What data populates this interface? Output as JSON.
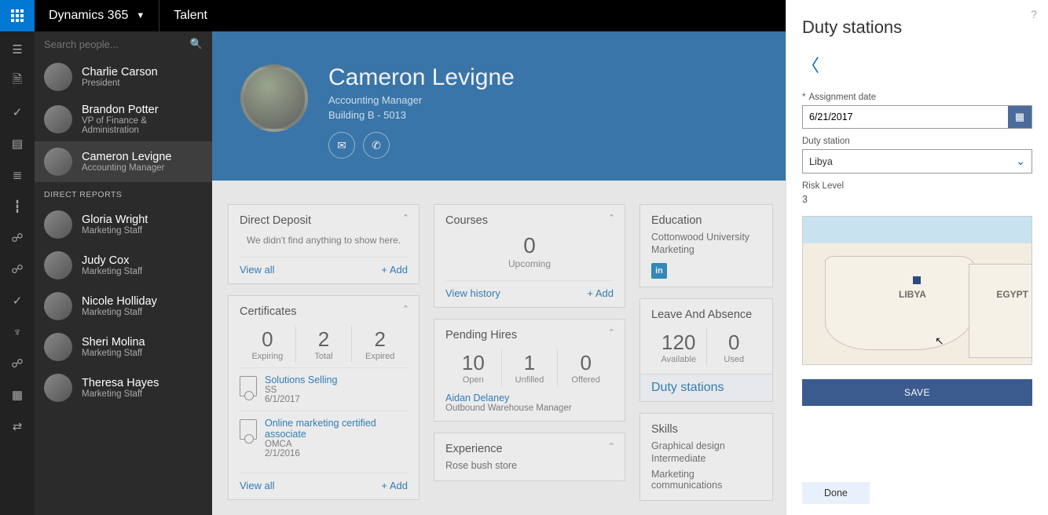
{
  "topbar": {
    "brand": "Dynamics 365",
    "module": "Talent"
  },
  "search": {
    "placeholder": "Search people..."
  },
  "people": [
    {
      "name": "Charlie Carson",
      "title": "President"
    },
    {
      "name": "Brandon Potter",
      "title": "VP of Finance & Administration"
    },
    {
      "name": "Cameron Levigne",
      "title": "Accounting Manager",
      "selected": true
    }
  ],
  "direct_reports_label": "DIRECT REPORTS",
  "reports": [
    {
      "name": "Gloria Wright",
      "title": "Marketing Staff"
    },
    {
      "name": "Judy Cox",
      "title": "Marketing Staff"
    },
    {
      "name": "Nicole Holliday",
      "title": "Marketing Staff"
    },
    {
      "name": "Sheri Molina",
      "title": "Marketing Staff"
    },
    {
      "name": "Theresa Hayes",
      "title": "Marketing Staff"
    }
  ],
  "hero": {
    "name": "Cameron Levigne",
    "role": "Accounting Manager",
    "building": "Building B - 5013"
  },
  "cards": {
    "direct_deposit": {
      "title": "Direct Deposit",
      "empty": "We didn't find anything to show here.",
      "view_all": "View all",
      "add": "Add"
    },
    "certificates": {
      "title": "Certificates",
      "stats": [
        {
          "n": "0",
          "l": "Expiring"
        },
        {
          "n": "2",
          "l": "Total"
        },
        {
          "n": "2",
          "l": "Expired"
        }
      ],
      "items": [
        {
          "title": "Solutions Selling",
          "sub": "SS",
          "date": "6/1/2017"
        },
        {
          "title": "Online marketing certified associate",
          "sub": "OMCA",
          "date": "2/1/2016"
        }
      ],
      "view_all": "View all",
      "add": "Add"
    },
    "courses": {
      "title": "Courses",
      "n": "0",
      "l": "Upcoming",
      "view_history": "View history",
      "add": "Add"
    },
    "pending_hires": {
      "title": "Pending Hires",
      "stats": [
        {
          "n": "10",
          "l": "Open"
        },
        {
          "n": "1",
          "l": "Unfilled"
        },
        {
          "n": "0",
          "l": "Offered"
        }
      ],
      "hire_name": "Aidan Delaney",
      "hire_role": "Outbound Warehouse Manager"
    },
    "experience": {
      "title": "Experience",
      "item": "Rose bush store"
    },
    "education": {
      "title": "Education",
      "school": "Cottonwood University",
      "dept": "Marketing"
    },
    "leave": {
      "title": "Leave And Absence",
      "stats": [
        {
          "n": "120",
          "l": "Available"
        },
        {
          "n": "0",
          "l": "Used"
        }
      ],
      "duty_link": "Duty stations"
    },
    "skills": {
      "title": "Skills",
      "items": [
        "Graphical design",
        "Intermediate",
        "Marketing communications"
      ]
    }
  },
  "panel": {
    "title": "Duty stations",
    "assignment_label": "Assignment date",
    "assignment_value": "6/21/2017",
    "station_label": "Duty station",
    "station_value": "Libya",
    "risk_label": "Risk Level",
    "risk_value": "3",
    "map_labels": {
      "libya": "LIBYA",
      "egypt": "EGYPT"
    },
    "save": "SAVE",
    "done": "Done",
    "help": "?"
  },
  "rail_icons": [
    "menu",
    "doc",
    "check",
    "clipboard",
    "list",
    "people-tree",
    "person-a",
    "person-b",
    "check2",
    "tree",
    "person-c",
    "grid",
    "swap"
  ]
}
